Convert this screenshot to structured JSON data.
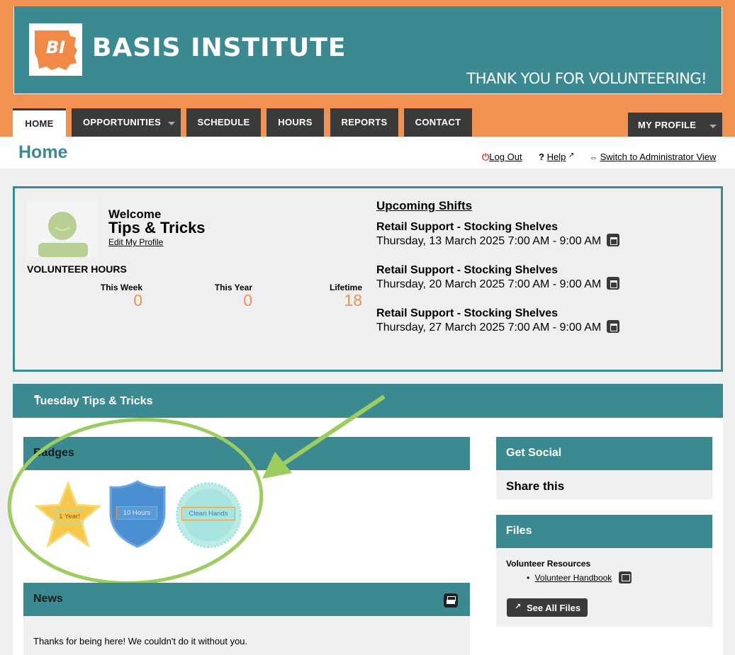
{
  "brand": {
    "logo_text": "BI",
    "name": "BASIS INSTITUTE",
    "tagline": "THANK YOU FOR VOLUNTEERING!"
  },
  "nav": {
    "home": "HOME",
    "opportunities": "OPPORTUNITIES",
    "schedule": "SCHEDULE",
    "hours": "HOURS",
    "reports": "REPORTS",
    "contact": "CONTACT",
    "my_profile": "MY PROFILE"
  },
  "page": {
    "title": "Home",
    "logout": "Log Out",
    "help": "Help",
    "switch_view": "Switch to Administrator View"
  },
  "welcome": {
    "label": "Welcome",
    "name": "Tips & Tricks",
    "edit_profile": "Edit My Profile",
    "hours_title": "VOLUNTEER HOURS",
    "stats": [
      {
        "label": "This Week",
        "value": "0"
      },
      {
        "label": "This Year",
        "value": "0"
      },
      {
        "label": "Lifetime",
        "value": "18"
      }
    ]
  },
  "shifts": {
    "title": "Upcoming Shifts",
    "items": [
      {
        "name": "Retail Support - Stocking Shelves",
        "time": "Thursday, 13 March 2025 7:00 AM - 9:00 AM"
      },
      {
        "name": "Retail Support - Stocking Shelves",
        "time": "Thursday, 20 March 2025 7:00 AM - 9:00 AM"
      },
      {
        "name": "Retail Support - Stocking Shelves",
        "time": "Thursday, 27 March 2025 7:00 AM - 9:00 AM"
      }
    ]
  },
  "section": {
    "title": "Tuesday Tips & Tricks"
  },
  "badges": {
    "title": "Badges",
    "items": [
      {
        "label": "1 Year!",
        "color": "#f5c84c"
      },
      {
        "label": "10 Hours",
        "color": "#4a8fd1"
      },
      {
        "label": "Clean Hands",
        "color": "#a8e4df"
      }
    ]
  },
  "news": {
    "title": "News",
    "text": "Thanks for being here! We couldn't do it without you."
  },
  "social": {
    "title": "Get Social",
    "share": "Share this"
  },
  "files": {
    "title": "Files",
    "group": "Volunteer Resources",
    "item": "Volunteer Handbook",
    "see_all": "See All Files"
  },
  "colors": {
    "teal": "#3b8a91",
    "orange": "#f29151",
    "dark": "#3a3a3a",
    "highlight": "#9dcc5f"
  }
}
